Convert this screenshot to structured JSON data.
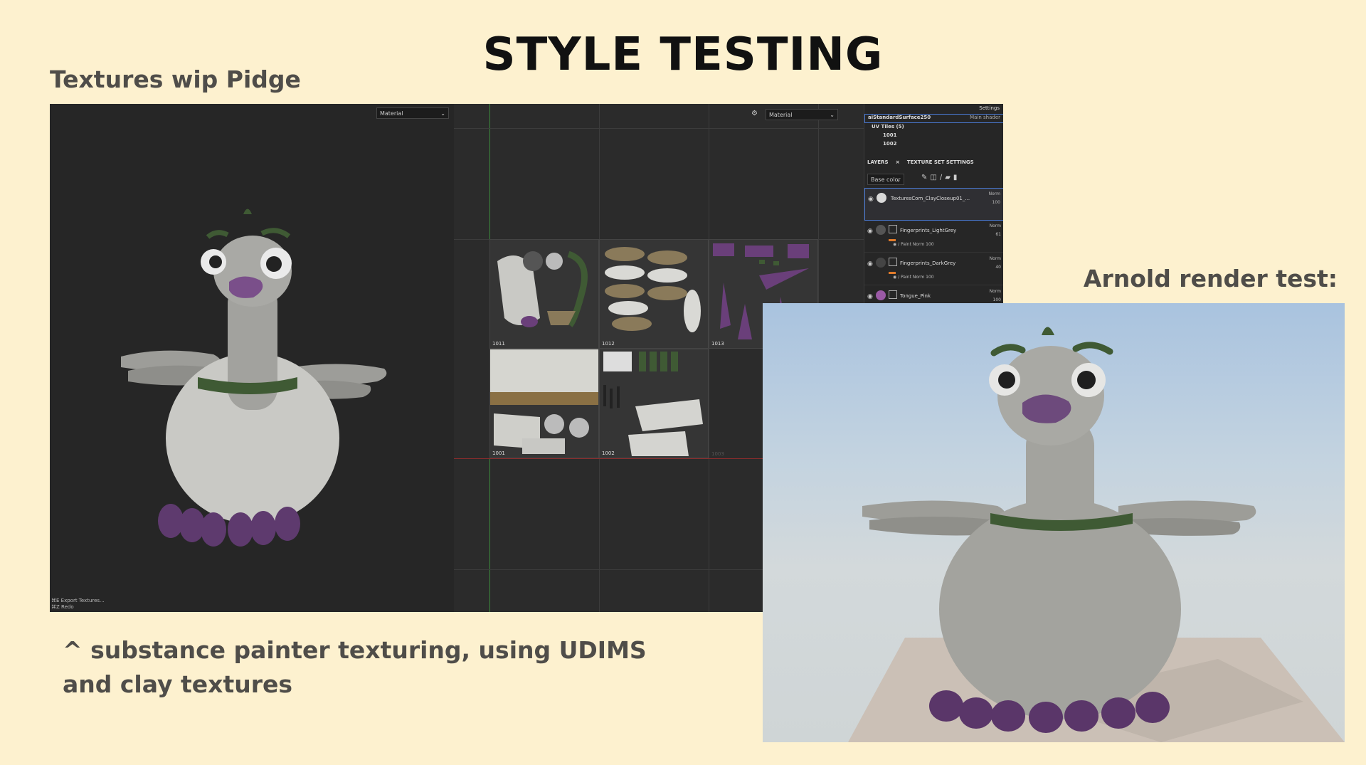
{
  "title": "STYLE TESTING",
  "left_label": "Textures wip Pidge",
  "right_label": "Arnold render test:",
  "caption": "^ substance painter texturing, using UDIMS and clay textures",
  "substance": {
    "viewport_dropdown": "Material",
    "uv_dropdown": "Material",
    "shortcuts": [
      "⌘E   Export Textures...",
      "⌘Z   Redo"
    ],
    "tiles": [
      {
        "label": "1011"
      },
      {
        "label": "1012"
      },
      {
        "label": "1013"
      },
      {
        "label": "1001"
      },
      {
        "label": "1002"
      },
      {
        "label": "1003"
      }
    ],
    "panel": {
      "settings": "Settings",
      "shader_name": "aiStandardSurface250",
      "shader_type": "Main shader",
      "uv_tiles": "UV Tiles (5)",
      "uv_tile_items": [
        "1001",
        "1002"
      ],
      "tabs": [
        "LAYERS",
        "TEXTURE SET SETTINGS"
      ],
      "channel": "Base color",
      "layers": [
        {
          "name": "TexturesCom_ClayCloseup01_...",
          "blend": "Norm",
          "opacity": "100",
          "thumb": "#d9d9d9",
          "selected": true
        },
        {
          "name": "Fingerprints_LightGrey",
          "blend": "Norm",
          "opacity": "61",
          "thumb": "#555555",
          "sub": "Paint",
          "sub_blend": "Norm",
          "sub_opacity": "100"
        },
        {
          "name": "Fingerprints_DarkGrey",
          "blend": "Norm",
          "opacity": "40",
          "thumb": "#444444",
          "sub": "Paint",
          "sub_blend": "Norm",
          "sub_opacity": "100"
        },
        {
          "name": "Tongue_Pink",
          "blend": "Norm",
          "opacity": "100",
          "thumb": "#9b5aa6"
        }
      ]
    }
  },
  "colors": {
    "background": "#fdf1cf",
    "body_grey": "#a9a9a5",
    "belly": "#cfcfcb",
    "purple": "#6a3f7a",
    "green": "#3f5a34"
  }
}
